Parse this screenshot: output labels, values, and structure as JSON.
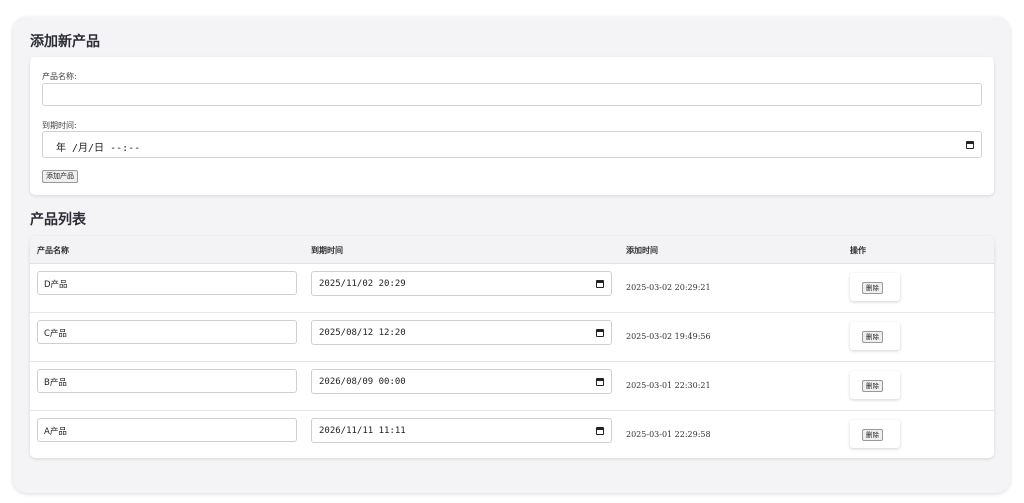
{
  "add_section": {
    "title": "添加新产品",
    "name_label": "产品名称:",
    "name_value": "",
    "date_label": "到期时间:",
    "date_placeholder": "年 /月/日 --:--",
    "add_button": "添加产品"
  },
  "list_section": {
    "title": "产品列表",
    "columns": [
      "产品名称",
      "到期时间",
      "添加时间",
      "操作"
    ],
    "rows": [
      {
        "name": "D产品",
        "expiry": "2025/11/02 20:29",
        "added": "2025-03-02 20:29:21",
        "action": "删除"
      },
      {
        "name": "C产品",
        "expiry": "2025/08/12 12:20",
        "added": "2025-03-02 19:49:56",
        "action": "删除"
      },
      {
        "name": "B产品",
        "expiry": "2026/08/09 00:00",
        "added": "2025-03-01 22:30:21",
        "action": "删除"
      },
      {
        "name": "A产品",
        "expiry": "2026/11/11 11:11",
        "added": "2025-03-01 22:29:58",
        "action": "删除"
      }
    ]
  },
  "icons": {
    "date_picker": "calendar-icon"
  }
}
